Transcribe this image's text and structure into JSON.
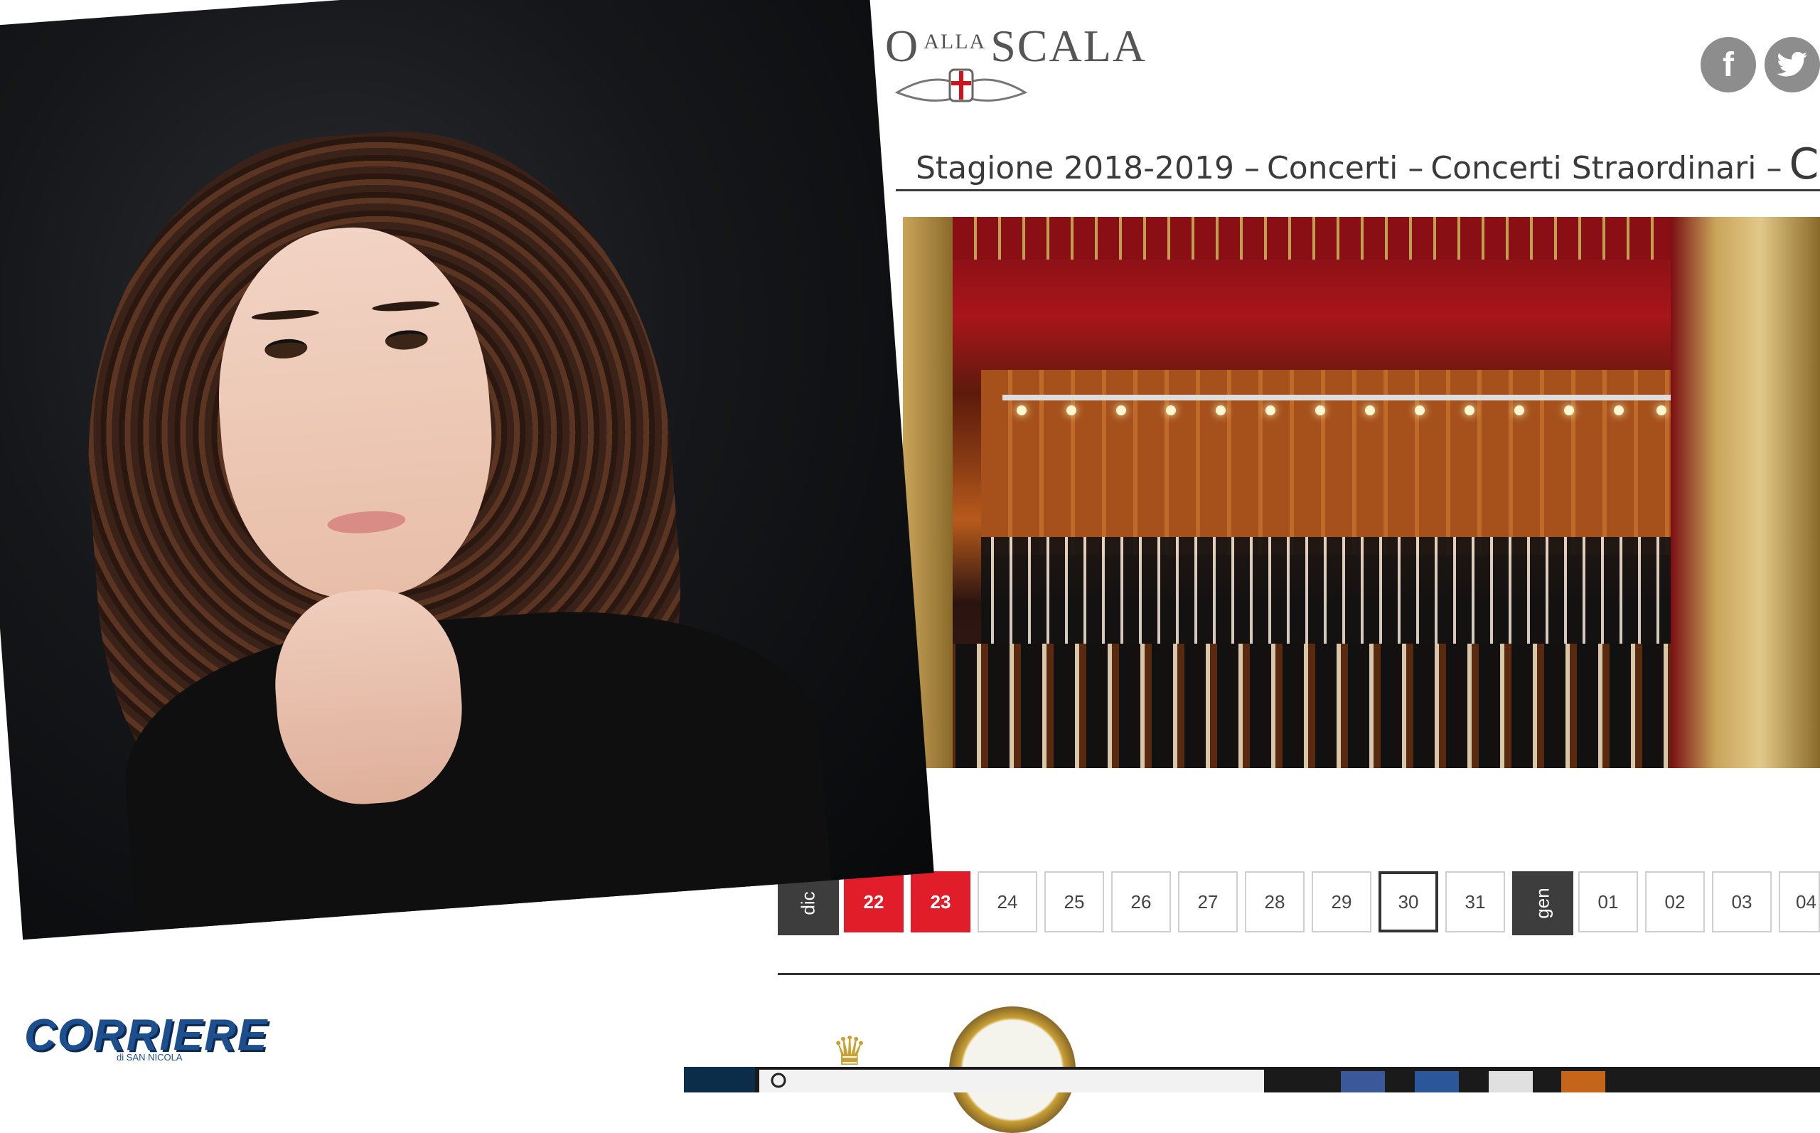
{
  "site": {
    "logo_text": "O",
    "logo_small": "ALLA",
    "logo_main": "SCALA",
    "social": {
      "facebook_label": "f",
      "twitter_label": "t"
    },
    "breadcrumb": [
      "Stagione 2018-2019",
      "Concerti",
      "Concerti Straordinari",
      "C"
    ],
    "breadcrumb_separator": "–"
  },
  "calendar": {
    "months": [
      "dic",
      "gen"
    ],
    "days_dic": [
      "22",
      "23",
      "24",
      "25",
      "26",
      "27",
      "28",
      "29",
      "30",
      "31"
    ],
    "days_gen": [
      "01",
      "02",
      "03",
      "04"
    ],
    "highlighted": [
      "22",
      "23"
    ],
    "current": "30",
    "accent_color": "#e01d28"
  },
  "watermark": {
    "brand": "CORRIERE",
    "tagline": "di SAN NICOLA"
  },
  "icons": [
    "facebook-icon",
    "twitter-icon",
    "rolex-crown-icon",
    "windows-start-icon",
    "search-icon"
  ]
}
